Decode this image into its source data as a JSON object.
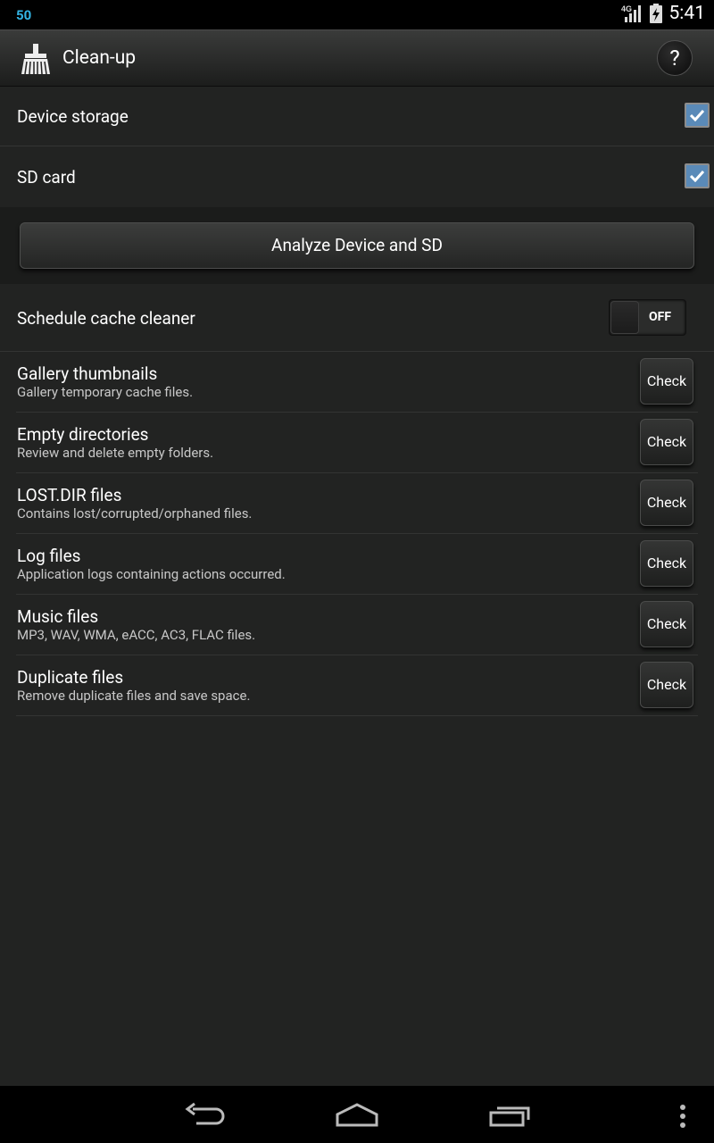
{
  "status_bar": {
    "notification": "50",
    "network": "4G",
    "time": "5:41"
  },
  "action_bar": {
    "title": "Clean-up",
    "help": "?"
  },
  "storage": {
    "device_storage": {
      "label": "Device storage",
      "checked": true
    },
    "sd_card": {
      "label": "SD card",
      "checked": true
    }
  },
  "analyze_button": "Analyze Device and SD",
  "schedule": {
    "label": "Schedule cache cleaner",
    "state": "OFF"
  },
  "items": [
    {
      "title": "Gallery thumbnails",
      "subtitle": "Gallery temporary cache files.",
      "button": "Check"
    },
    {
      "title": "Empty directories",
      "subtitle": "Review and delete empty folders.",
      "button": "Check"
    },
    {
      "title": "LOST.DIR files",
      "subtitle": "Contains lost/corrupted/orphaned files.",
      "button": "Check"
    },
    {
      "title": "Log files",
      "subtitle": "Application logs containing actions occurred.",
      "button": "Check"
    },
    {
      "title": "Music files",
      "subtitle": "MP3, WAV, WMA, eACC, AC3, FLAC files.",
      "button": "Check"
    },
    {
      "title": "Duplicate files",
      "subtitle": "Remove duplicate files and save space.",
      "button": "Check"
    }
  ],
  "colors": {
    "background": "#222322",
    "accent_blue": "#33b5e5",
    "checkbox_fill": "#5a8ab8"
  }
}
